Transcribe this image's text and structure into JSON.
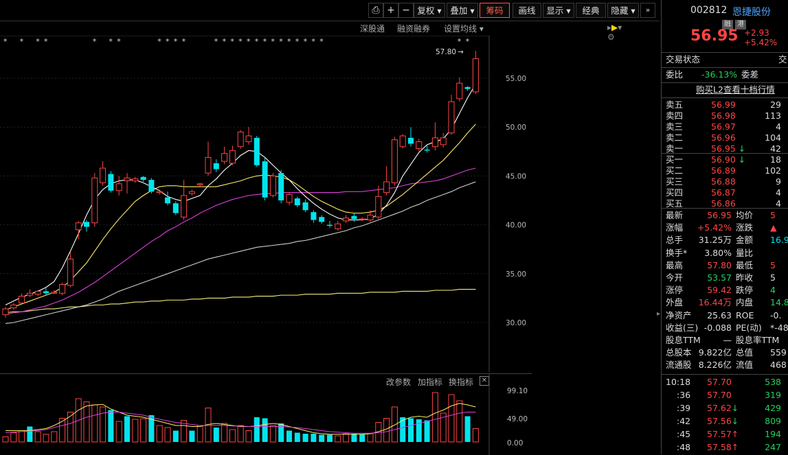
{
  "toolbar": {
    "buttons": [
      "复权",
      "叠加",
      "筹码",
      "画线",
      "显示",
      "经典",
      "隐藏"
    ],
    "active": "筹码"
  },
  "subbar": {
    "links": [
      "深股通",
      "融资融券",
      "设置均线"
    ]
  },
  "price_axis": [
    "55.00",
    "50.00",
    "45.00",
    "40.00",
    "35.00",
    "30.00"
  ],
  "high_label": "57.80",
  "volume_axis": [
    "99.10",
    "49.00",
    "0.00"
  ],
  "lower_links": [
    "改参数",
    "加指标",
    "换指标"
  ],
  "stock": {
    "code": "002812",
    "name": "恩捷股份",
    "tags": [
      "融",
      "港"
    ],
    "price": "56.95",
    "change": "+2.93",
    "change_pct": "+5.42%"
  },
  "status": {
    "label": "交易状态",
    "right": "交"
  },
  "weibi": {
    "label": "委比",
    "value": "-36.13%",
    "label2": "委差",
    "value2": "4"
  },
  "l2_link": "购买L2查看十档行情",
  "asks": [
    {
      "label": "卖五",
      "price": "56.99",
      "vol": "29"
    },
    {
      "label": "卖四",
      "price": "56.98",
      "vol": "113"
    },
    {
      "label": "卖三",
      "price": "56.97",
      "vol": "4"
    },
    {
      "label": "卖二",
      "price": "56.96",
      "vol": "104"
    },
    {
      "label": "卖一",
      "price": "56.95",
      "vol": "42",
      "arrow": "↓"
    }
  ],
  "bids": [
    {
      "label": "买一",
      "price": "56.90",
      "vol": "18",
      "arrow": "↓"
    },
    {
      "label": "买二",
      "price": "56.89",
      "vol": "102"
    },
    {
      "label": "买三",
      "price": "56.88",
      "vol": "9"
    },
    {
      "label": "买四",
      "price": "56.87",
      "vol": "4"
    },
    {
      "label": "买五",
      "price": "56.86",
      "vol": "4"
    }
  ],
  "stats": [
    {
      "l": "最新",
      "v": "56.95",
      "vc": "red",
      "l2": "均价",
      "v2": "5",
      "v2c": "red"
    },
    {
      "l": "涨幅",
      "v": "+5.42%",
      "vc": "red",
      "l2": "涨跌",
      "v2": "▲",
      "v2c": "red"
    },
    {
      "l": "总手",
      "v": "31.25万",
      "vc": "white",
      "l2": "金额",
      "v2": "16.9",
      "v2c": "cyan"
    },
    {
      "l": "换手*",
      "v": "3.80%",
      "vc": "white",
      "l2": "量比",
      "v2": "",
      "v2c": "white"
    },
    {
      "l": "最高",
      "v": "57.80",
      "vc": "red",
      "l2": "最低",
      "v2": "5",
      "v2c": "red"
    },
    {
      "l": "今开",
      "v": "53.57",
      "vc": "green",
      "l2": "昨收",
      "v2": "5",
      "v2c": "white"
    },
    {
      "l": "涨停",
      "v": "59.42",
      "vc": "red",
      "l2": "跌停",
      "v2": "4",
      "v2c": "green"
    },
    {
      "l": "外盘",
      "v": "16.44万",
      "vc": "red",
      "l2": "内盘",
      "v2": "14.8",
      "v2c": "green"
    },
    {
      "l": "净资产",
      "v": "25.63",
      "vc": "white",
      "l2": "ROE",
      "v2": "-0.",
      "v2c": "white"
    },
    {
      "l": "收益(三)",
      "v": "-0.088",
      "vc": "white",
      "l2": "PE(动)",
      "v2": "*-48",
      "v2c": "white"
    },
    {
      "l": "股息TTM",
      "v": "—",
      "vc": "white",
      "l2": "股息率TTM",
      "v2": "",
      "v2c": "white"
    },
    {
      "l": "总股本",
      "v": "9.822亿",
      "vc": "white",
      "l2": "总值",
      "v2": "559",
      "v2c": "white"
    },
    {
      "l": "流通股",
      "v": "8.226亿",
      "vc": "white",
      "l2": "流值",
      "v2": "468",
      "v2c": "white"
    }
  ],
  "ticks": [
    {
      "t": "10:18",
      "p": "57.70",
      "v": "538",
      "arrow": ""
    },
    {
      "t": ":36",
      "p": "57.70",
      "v": "319",
      "arrow": ""
    },
    {
      "t": ":39",
      "p": "57.62",
      "v": "429",
      "arrow": "↓"
    },
    {
      "t": ":42",
      "p": "57.56",
      "v": "809",
      "arrow": "↓"
    },
    {
      "t": ":45",
      "p": "57.57",
      "v": "194",
      "arrow": "↑"
    },
    {
      "t": ":48",
      "p": "57.58",
      "v": "247",
      "arrow": "↑"
    }
  ],
  "colors": {
    "up": "#ff4545",
    "down": "#00e5ee",
    "bg": "#000000"
  },
  "candles": [
    [
      30.8,
      31.4,
      30.5,
      31.6
    ],
    [
      31.5,
      31.8,
      31.3,
      32.0
    ],
    [
      32.0,
      32.7,
      31.8,
      33.0
    ],
    [
      32.8,
      33.0,
      32.6,
      33.4
    ],
    [
      32.9,
      33.2,
      32.7,
      33.3
    ],
    [
      33.2,
      33.0,
      32.8,
      33.5
    ],
    [
      33.0,
      33.1,
      32.9,
      33.3
    ],
    [
      33.0,
      33.9,
      32.8,
      34.1
    ],
    [
      33.8,
      36.5,
      33.6,
      37.2
    ],
    [
      39.5,
      40.2,
      38.5,
      40.4
    ],
    [
      40.3,
      39.8,
      39.3,
      40.5
    ],
    [
      40.2,
      44.8,
      39.8,
      45.3
    ],
    [
      44.3,
      45.8,
      44.0,
      46.5
    ],
    [
      45.2,
      43.5,
      43.3,
      45.5
    ],
    [
      43.5,
      44.2,
      43.0,
      45.0
    ],
    [
      44.5,
      44.8,
      43.2,
      45.3
    ],
    [
      44.5,
      44.7,
      44.3,
      44.9
    ],
    [
      44.9,
      44.6,
      44.4,
      45.0
    ],
    [
      44.6,
      43.4,
      43.2,
      44.8
    ],
    [
      43.3,
      43.4,
      43.1,
      43.6
    ],
    [
      42.8,
      42.2,
      42.0,
      43.4
    ],
    [
      42.2,
      41.2,
      41.0,
      42.4
    ],
    [
      40.8,
      43.0,
      40.5,
      44.6
    ],
    [
      43.2,
      43.4,
      43.0,
      43.6
    ],
    [
      44.1,
      44.2,
      43.9,
      44.3
    ],
    [
      45.3,
      46.9,
      45.0,
      48.5
    ],
    [
      46.3,
      45.7,
      45.4,
      46.7
    ],
    [
      46.5,
      47.3,
      46.2,
      48.0
    ],
    [
      46.3,
      47.6,
      46.1,
      48.1
    ],
    [
      48.0,
      49.5,
      47.8,
      49.7
    ],
    [
      48.5,
      49.1,
      48.2,
      50.0
    ],
    [
      48.9,
      46.1,
      45.9,
      49.1
    ],
    [
      46.5,
      42.8,
      42.5,
      46.9
    ],
    [
      43.0,
      45.0,
      42.8,
      45.3
    ],
    [
      45.3,
      42.5,
      42.2,
      45.6
    ],
    [
      42.3,
      43.1,
      42.0,
      43.3
    ],
    [
      42.7,
      42.0,
      41.8,
      42.9
    ],
    [
      42.3,
      41.5,
      41.3,
      42.6
    ],
    [
      41.3,
      40.5,
      40.2,
      41.5
    ],
    [
      40.8,
      40.3,
      40.1,
      41.0
    ],
    [
      40.0,
      39.9,
      39.7,
      40.4
    ],
    [
      39.6,
      40.1,
      39.4,
      40.4
    ],
    [
      40.4,
      40.7,
      40.2,
      41.0
    ],
    [
      40.9,
      40.6,
      40.3,
      41.2
    ],
    [
      40.6,
      40.6,
      40.4,
      40.8
    ],
    [
      40.5,
      41.0,
      40.3,
      41.5
    ],
    [
      40.8,
      42.9,
      40.6,
      44.0
    ],
    [
      43.3,
      44.4,
      43.0,
      46.0
    ],
    [
      44.3,
      48.7,
      44.0,
      49.0
    ],
    [
      48.0,
      49.1,
      47.8,
      49.3
    ],
    [
      48.9,
      48.3,
      48.0,
      50.0
    ],
    [
      47.8,
      48.5,
      47.5,
      48.8
    ],
    [
      47.7,
      47.6,
      47.4,
      48.2
    ],
    [
      48.0,
      48.9,
      47.6,
      50.5
    ],
    [
      48.2,
      48.9,
      47.9,
      49.4
    ],
    [
      49.4,
      52.6,
      49.2,
      53.3
    ],
    [
      52.9,
      54.5,
      52.6,
      55.1
    ],
    [
      54.1,
      53.9,
      53.7,
      54.2
    ],
    [
      53.6,
      57.0,
      53.4,
      57.8
    ]
  ],
  "volumes": [
    [
      0.1,
      1
    ],
    [
      0.18,
      1
    ],
    [
      0.22,
      1
    ],
    [
      0.3,
      0
    ],
    [
      0.2,
      1
    ],
    [
      0.15,
      1
    ],
    [
      0.2,
      1
    ],
    [
      0.46,
      1
    ],
    [
      0.58,
      1
    ],
    [
      0.84,
      1
    ],
    [
      0.78,
      1
    ],
    [
      0.72,
      1
    ],
    [
      0.68,
      1
    ],
    [
      0.62,
      0
    ],
    [
      0.4,
      1
    ],
    [
      0.5,
      0
    ],
    [
      0.44,
      1
    ],
    [
      0.45,
      1
    ],
    [
      0.52,
      0
    ],
    [
      0.32,
      1
    ],
    [
      0.28,
      1
    ],
    [
      0.22,
      0
    ],
    [
      0.42,
      1
    ],
    [
      0.22,
      0
    ],
    [
      0.32,
      1
    ],
    [
      0.66,
      1
    ],
    [
      0.28,
      0
    ],
    [
      0.36,
      1
    ],
    [
      0.24,
      1
    ],
    [
      0.32,
      1
    ],
    [
      0.22,
      1
    ],
    [
      0.48,
      0
    ],
    [
      0.46,
      0
    ],
    [
      0.32,
      1
    ],
    [
      0.36,
      0
    ],
    [
      0.22,
      0
    ],
    [
      0.18,
      0
    ],
    [
      0.16,
      0
    ],
    [
      0.16,
      0
    ],
    [
      0.14,
      0
    ],
    [
      0.14,
      0
    ],
    [
      0.12,
      1
    ],
    [
      0.16,
      1
    ],
    [
      0.16,
      0
    ],
    [
      0.15,
      0
    ],
    [
      0.16,
      1
    ],
    [
      0.38,
      1
    ],
    [
      0.46,
      1
    ],
    [
      0.68,
      1
    ],
    [
      0.48,
      0
    ],
    [
      0.46,
      0
    ],
    [
      0.44,
      0
    ],
    [
      0.42,
      0
    ],
    [
      0.96,
      1
    ],
    [
      0.56,
      1
    ],
    [
      0.92,
      1
    ],
    [
      0.8,
      1
    ],
    [
      0.5,
      0
    ],
    [
      0.26,
      1
    ]
  ],
  "ma5": [
    31.8,
    32.2,
    32.6,
    32.9,
    33.2,
    33.6,
    34.2,
    35.6,
    37.3,
    39.1,
    41.0,
    42.6,
    43.6,
    44.2,
    44.5,
    44.6,
    44.6,
    44.3,
    43.9,
    43.5,
    42.9,
    42.6,
    42.4,
    42.7,
    43.0,
    44.0,
    44.7,
    45.6,
    46.3,
    47.1,
    47.6,
    47.5,
    46.9,
    46.1,
    45.3,
    44.6,
    43.7,
    42.9,
    42.2,
    41.6,
    41.1,
    40.7,
    40.5,
    40.5,
    40.5,
    40.6,
    41.1,
    42.0,
    43.3,
    45.0,
    46.2,
    47.4,
    48.2,
    48.5,
    48.8,
    49.8,
    51.4,
    53.0,
    54.4
  ],
  "ma10": [
    31.3,
    31.6,
    31.9,
    32.2,
    32.5,
    32.8,
    33.1,
    33.6,
    34.3,
    35.2,
    36.1,
    37.3,
    38.5,
    39.6,
    40.6,
    41.5,
    42.4,
    43.0,
    43.5,
    43.9,
    44.0,
    44.0,
    43.9,
    43.9,
    43.9,
    43.9,
    43.9,
    44.1,
    44.3,
    44.5,
    44.8,
    45.0,
    45.1,
    45.0,
    44.9,
    44.6,
    44.1,
    43.5,
    42.9,
    42.4,
    42.0,
    41.6,
    41.3,
    41.2,
    41.2,
    41.3,
    41.5,
    41.9,
    42.5,
    43.1,
    43.8,
    44.5,
    45.2,
    45.9,
    46.6,
    47.5,
    48.4,
    49.4,
    50.3
  ],
  "ma20": [
    30.8,
    31.0,
    31.1,
    31.3,
    31.5,
    31.7,
    32.0,
    32.3,
    32.7,
    33.1,
    33.6,
    34.1,
    34.7,
    35.3,
    35.9,
    36.5,
    37.1,
    37.7,
    38.3,
    38.8,
    39.4,
    39.8,
    40.3,
    40.7,
    41.2,
    41.6,
    42.0,
    42.3,
    42.6,
    42.8,
    43.0,
    43.1,
    43.2,
    43.2,
    43.3,
    43.3,
    43.3,
    43.3,
    43.3,
    43.3,
    43.3,
    43.3,
    43.4,
    43.4,
    43.4,
    43.5,
    43.6,
    43.7,
    43.8,
    44.0,
    44.2,
    44.3,
    44.4,
    44.5,
    44.7,
    45.0,
    45.3,
    45.6,
    45.8
  ],
  "ma60": [
    29.9,
    30.0,
    30.2,
    30.4,
    30.6,
    30.8,
    31.0,
    31.2,
    31.4,
    31.6,
    31.8,
    32.1,
    32.4,
    32.8,
    33.2,
    33.5,
    33.8,
    34.1,
    34.4,
    34.7,
    35.0,
    35.3,
    35.6,
    35.9,
    36.2,
    36.5,
    36.7,
    36.9,
    37.1,
    37.3,
    37.5,
    37.7,
    37.8,
    37.9,
    38.0,
    38.1,
    38.3,
    38.4,
    38.6,
    38.8,
    39.0,
    39.2,
    39.4,
    39.7,
    39.9,
    40.2,
    40.5,
    40.8,
    41.1,
    41.4,
    41.8,
    42.1,
    42.5,
    42.8,
    43.1,
    43.4,
    43.8,
    44.1,
    44.4
  ],
  "ma250": [
    31.0,
    31.1,
    31.1,
    31.2,
    31.3,
    31.4,
    31.4,
    31.5,
    31.6,
    31.6,
    31.7,
    31.8,
    31.8,
    31.9,
    31.9,
    32.0,
    32.1,
    32.1,
    32.2,
    32.2,
    32.3,
    32.3,
    32.3,
    32.4,
    32.4,
    32.5,
    32.5,
    32.5,
    32.6,
    32.6,
    32.6,
    32.7,
    32.7,
    32.7,
    32.8,
    32.8,
    32.8,
    32.9,
    32.9,
    32.9,
    32.9,
    33.0,
    33.0,
    33.0,
    33.0,
    33.1,
    33.1,
    33.1,
    33.1,
    33.2,
    33.2,
    33.2,
    33.2,
    33.3,
    33.3,
    33.3,
    33.4,
    33.4,
    33.4
  ],
  "vol_ma1": [
    0.22,
    0.22,
    0.22,
    0.22,
    0.24,
    0.26,
    0.32,
    0.4,
    0.5,
    0.62,
    0.7,
    0.72,
    0.73,
    0.64,
    0.58,
    0.52,
    0.5,
    0.48,
    0.44,
    0.4,
    0.36,
    0.32,
    0.32,
    0.3,
    0.3,
    0.34,
    0.36,
    0.34,
    0.32,
    0.3,
    0.3,
    0.31,
    0.34,
    0.36,
    0.34,
    0.3,
    0.26,
    0.22,
    0.18,
    0.16,
    0.15,
    0.15,
    0.15,
    0.15,
    0.15,
    0.16,
    0.2,
    0.25,
    0.33,
    0.42,
    0.48,
    0.5,
    0.48,
    0.56,
    0.62,
    0.7,
    0.75,
    0.72,
    0.68
  ],
  "vol_ma2": [
    0.18,
    0.19,
    0.2,
    0.21,
    0.22,
    0.24,
    0.28,
    0.32,
    0.36,
    0.42,
    0.48,
    0.52,
    0.56,
    0.58,
    0.58,
    0.56,
    0.54,
    0.52,
    0.48,
    0.44,
    0.41,
    0.38,
    0.36,
    0.34,
    0.32,
    0.32,
    0.32,
    0.32,
    0.31,
    0.31,
    0.3,
    0.3,
    0.3,
    0.3,
    0.3,
    0.29,
    0.28,
    0.26,
    0.24,
    0.22,
    0.2,
    0.19,
    0.18,
    0.17,
    0.17,
    0.17,
    0.18,
    0.2,
    0.24,
    0.28,
    0.32,
    0.36,
    0.4,
    0.44,
    0.48,
    0.52,
    0.56,
    0.58,
    0.58
  ],
  "stars": [
    1,
    0,
    1,
    0,
    1,
    1,
    0,
    0,
    0,
    0,
    0,
    1,
    0,
    1,
    1,
    0,
    0,
    0,
    0,
    1,
    1,
    1,
    1,
    0,
    0,
    0,
    1,
    1,
    1,
    1,
    1,
    1,
    1,
    1,
    1,
    1,
    1,
    1,
    1,
    1,
    0,
    0,
    0,
    0,
    0,
    0,
    0,
    0,
    0,
    0,
    0,
    0,
    0,
    0,
    0,
    0,
    1,
    1,
    0
  ]
}
